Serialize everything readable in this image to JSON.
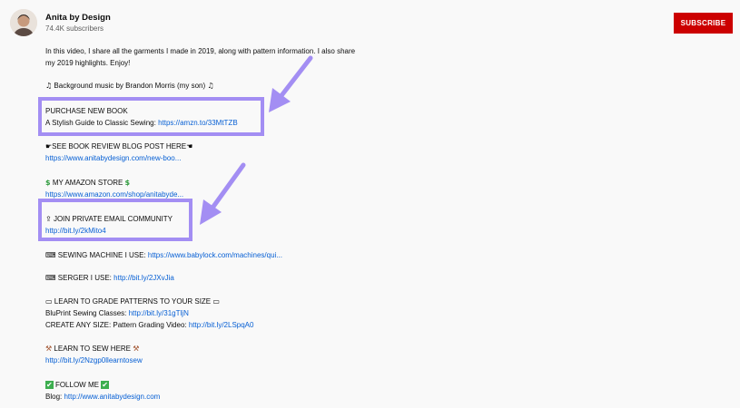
{
  "channel": {
    "name": "Anita by Design",
    "subscribers": "74.4K subscribers",
    "subscribe_label": "SUBSCRIBE"
  },
  "description": {
    "intro_1": "In this video, I share all the garments I made in 2019, along with pattern information. I also share",
    "intro_2": "my 2019 highlights. Enjoy!",
    "music": "Background music by Brandon Morris (my son)",
    "book_title": "PURCHASE NEW BOOK",
    "book_text": "A Stylish Guide to Classic Sewing: ",
    "book_link": "https://amzn.to/33MtTZB",
    "blog_title": "SEE BOOK REVIEW BLOG POST HERE",
    "blog_link": "https://www.anitabydesign.com/new-boo...",
    "amazon_title": "MY AMAZON STORE",
    "amazon_link": "https://www.amazon.com/shop/anitabyde...",
    "email_title": "JOIN PRIVATE EMAIL COMMUNITY",
    "email_link": "http://bit.ly/2kMito4",
    "machine_text": "SEWING MACHINE I USE: ",
    "machine_link": "https://www.babylock.com/machines/qui...",
    "serger_text": "SERGER I USE: ",
    "serger_link": "http://bit.ly/2JXvJia",
    "grade_title": "LEARN TO GRADE PATTERNS TO YOUR SIZE",
    "bluprint_text": "BluPrint Sewing Classes: ",
    "bluprint_link": "http://bit.ly/31gTljN",
    "create_text": "CREATE ANY SIZE: Pattern Grading Video: ",
    "create_link": "http://bit.ly/2LSpqA0",
    "learn_title": "LEARN TO SEW HERE",
    "learn_link": "http://bit.ly/2Nzgp0llearntosew",
    "follow_title": "FOLLOW ME",
    "blog_label": "Blog:  ",
    "site_link": "http://www.anitabydesign.com"
  },
  "colors": {
    "subscribe": "#cc0000",
    "link": "#065fd4",
    "highlight": "#a38ef3",
    "background": "#f9f9f9"
  },
  "icons": {
    "music": "music-note-emoji",
    "blog": "pointing-hand-emoji",
    "amazon": "heavy-dollar-sign-emoji",
    "email": "outbox-tray-emoji",
    "machine": "sewing-machine-emoji",
    "grade": "laptop-emoji",
    "learn": "hammer-and-pick-emoji",
    "follow": "check-mark-button-emoji"
  }
}
